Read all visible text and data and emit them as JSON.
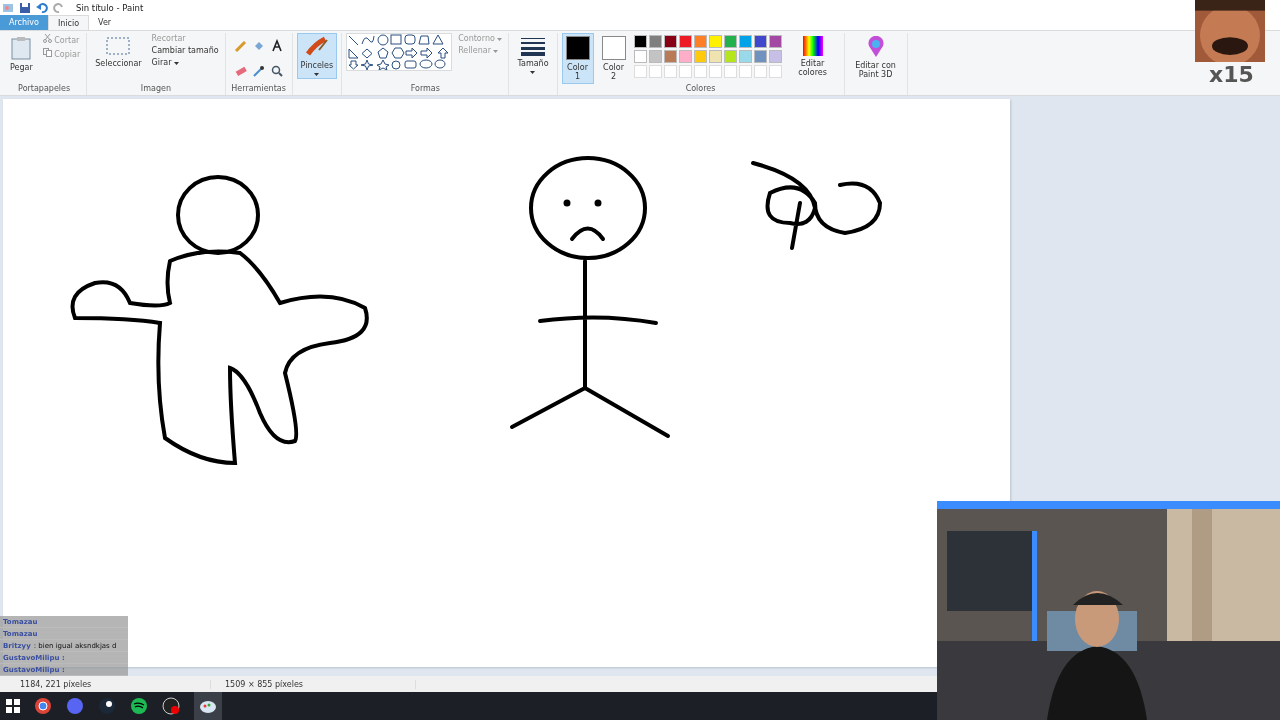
{
  "window": {
    "title": "Sin título - Paint"
  },
  "tabs": [
    {
      "label": "Archivo",
      "kind": "file",
      "selected": false
    },
    {
      "label": "Inicio",
      "kind": "tab",
      "selected": true
    },
    {
      "label": "Ver",
      "kind": "tab",
      "selected": false
    }
  ],
  "ribbon": {
    "clipboard": {
      "paste": "Pegar",
      "cut": "Cortar",
      "copy": "Copiar",
      "group": "Portapapeles"
    },
    "image": {
      "select": "Seleccionar",
      "crop": "Recortar",
      "resize": "Cambiar tamaño",
      "rotate": "Girar",
      "group": "Imagen"
    },
    "tools": {
      "group": "Herramientas"
    },
    "brushes": {
      "label": "Pinceles",
      "selected": true
    },
    "shapes": {
      "outline": "Contorno",
      "fill": "Rellenar",
      "group": "Formas"
    },
    "size": {
      "label": "Tamaño"
    },
    "colors": {
      "color1": "Color",
      "color1_num": "1",
      "color2": "Color",
      "color2_num": "2",
      "group": "Colores",
      "edit": "Editar colores",
      "paint3d": "Editar con Paint 3D",
      "palette": [
        {
          "color": "#000000"
        },
        {
          "color": "#7f7f7f"
        },
        {
          "color": "#880015"
        },
        {
          "color": "#ed1c24"
        },
        {
          "color": "#ff7f27"
        },
        {
          "color": "#fff200"
        },
        {
          "color": "#22b14c"
        },
        {
          "color": "#00a2e8"
        },
        {
          "color": "#3f48cc"
        },
        {
          "color": "#a349a4"
        },
        {
          "color": "#ffffff"
        },
        {
          "color": "#c3c3c3"
        },
        {
          "color": "#b97a57"
        },
        {
          "color": "#ffaec9"
        },
        {
          "color": "#ffc90e"
        },
        {
          "color": "#efe4b0"
        },
        {
          "color": "#b5e61d"
        },
        {
          "color": "#99d9ea"
        },
        {
          "color": "#7092be"
        },
        {
          "color": "#c8bfe7"
        }
      ]
    }
  },
  "status_bar": {
    "cursor": "1184, 221 píxeles",
    "size": "1509 × 855 píxeles"
  },
  "chat": [
    {
      "user": "Tomazau"
    },
    {
      "user": "Tomazau"
    },
    {
      "user": "Britzyy",
      "message": ": bien igual aksndkjas d"
    },
    {
      "user": "GustavoMilipu :"
    },
    {
      "user": "GustavoMilipu :"
    }
  ],
  "emote_overlay": {
    "count": "x15"
  }
}
